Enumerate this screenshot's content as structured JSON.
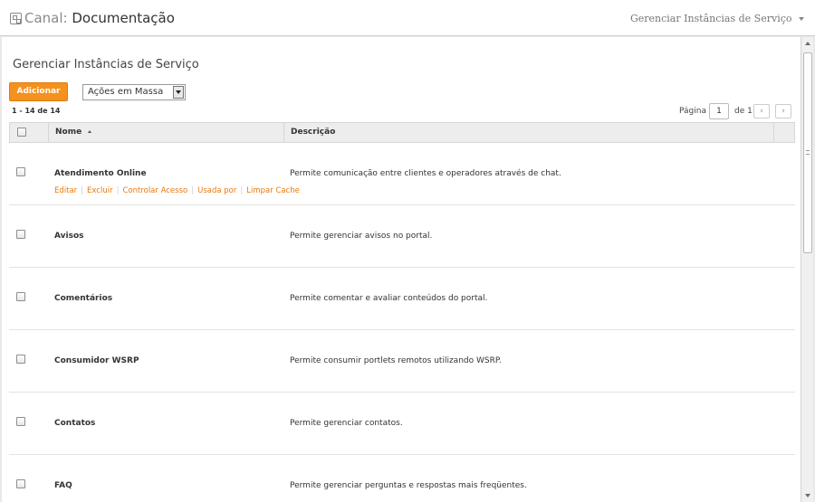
{
  "header": {
    "channel_label": "Canal:",
    "channel_name": "Documentação",
    "menu_label": "Gerenciar Instâncias de Serviço"
  },
  "main": {
    "title": "Gerenciar Instâncias de Serviço",
    "add_label": "Adicionar",
    "bulk_actions": "Ações em Massa",
    "count_text": "1 - 14 de 14",
    "pager": {
      "page_label": "Página",
      "page_value": "1",
      "of_label": "de 1",
      "prev": "‹",
      "next": "›"
    },
    "columns": {
      "name": "Nome",
      "description": "Descrição"
    },
    "rows": [
      {
        "name": "Atendimento Online",
        "description": "Permite comunicação entre clientes e operadores através de chat.",
        "actions": [
          "Editar",
          "Excluir",
          "Controlar Acesso",
          "Usada por",
          "Limpar Cache"
        ]
      },
      {
        "name": "Avisos",
        "description": "Permite gerenciar avisos no portal."
      },
      {
        "name": "Comentários",
        "description": "Permite comentar e avaliar conteúdos do portal."
      },
      {
        "name": "Consumidor WSRP",
        "description": "Permite consumir portlets remotos utilizando WSRP."
      },
      {
        "name": "Contatos",
        "description": "Permite gerenciar contatos."
      },
      {
        "name": "FAQ",
        "description": "Permite gerenciar perguntas e respostas mais freqüentes."
      }
    ]
  },
  "colors": {
    "accent": "#f5911f",
    "link": "#e8780c"
  }
}
